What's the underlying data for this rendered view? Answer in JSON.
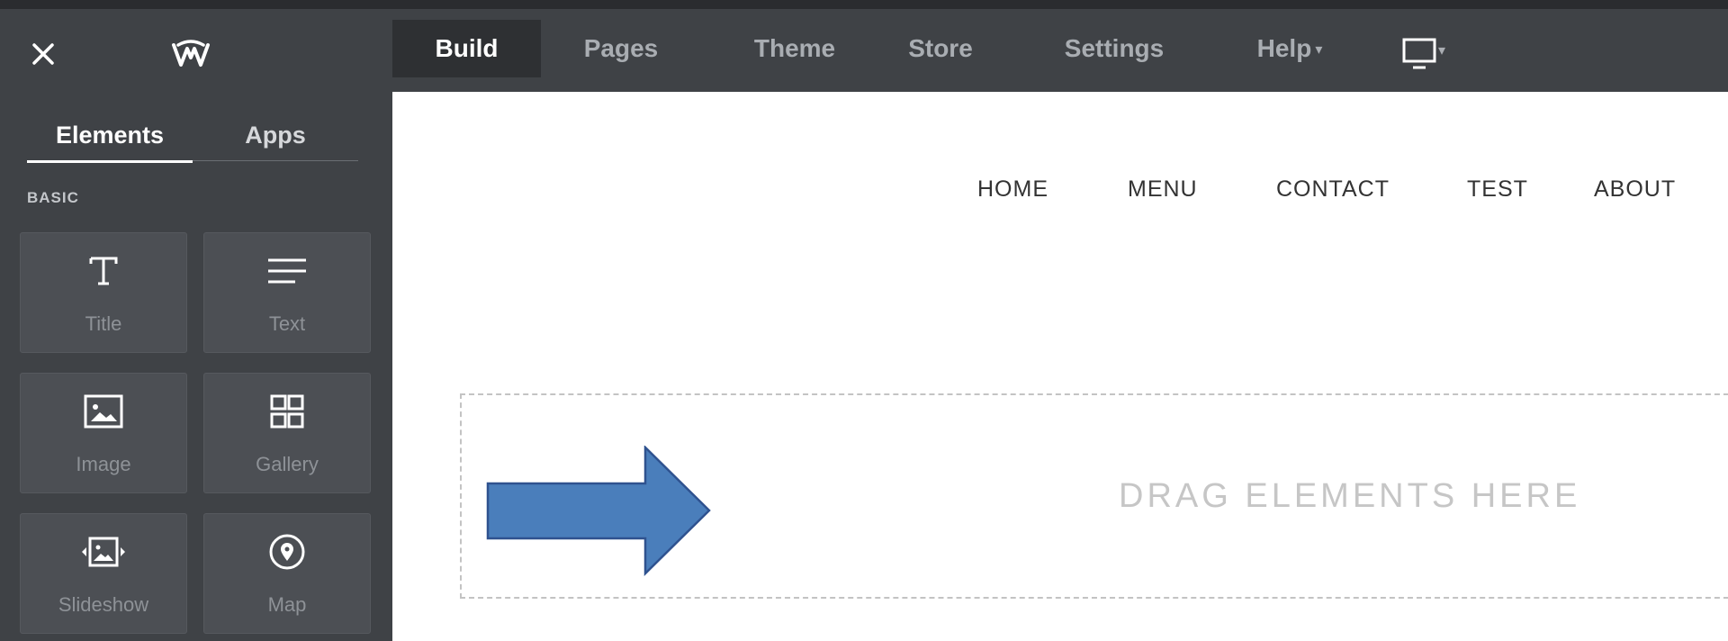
{
  "topbar": {
    "close_icon": "close-icon",
    "logo_icon": "weebly-logo-icon",
    "nav": [
      {
        "label": "Build",
        "active": true
      },
      {
        "label": "Pages"
      },
      {
        "label": "Theme"
      },
      {
        "label": "Store"
      },
      {
        "label": "Settings"
      },
      {
        "label": "Help",
        "caret": "▾"
      }
    ],
    "device_icon": "desktop-preview-icon",
    "device_caret": "▾"
  },
  "sidebar": {
    "tabs": [
      {
        "label": "Elements",
        "active": true
      },
      {
        "label": "Apps"
      }
    ],
    "section_label": "BASIC",
    "tiles": [
      {
        "label": "Title",
        "icon": "title-icon"
      },
      {
        "label": "Text",
        "icon": "text-icon"
      },
      {
        "label": "Image",
        "icon": "image-icon"
      },
      {
        "label": "Gallery",
        "icon": "gallery-icon"
      },
      {
        "label": "Slideshow",
        "icon": "slideshow-icon"
      },
      {
        "label": "Map",
        "icon": "map-icon"
      }
    ]
  },
  "site": {
    "nav": [
      "HOME",
      "MENU",
      "CONTACT",
      "TEST",
      "ABOUT"
    ],
    "drop_zone_text": "DRAG ELEMENTS HERE"
  },
  "colors": {
    "topbar_bg": "#3f4246",
    "sidebar_bg": "#3f4246",
    "active_nav_bg": "#2e3033",
    "arrow_fill": "#4a7ebb",
    "arrow_stroke": "#2f528f"
  }
}
